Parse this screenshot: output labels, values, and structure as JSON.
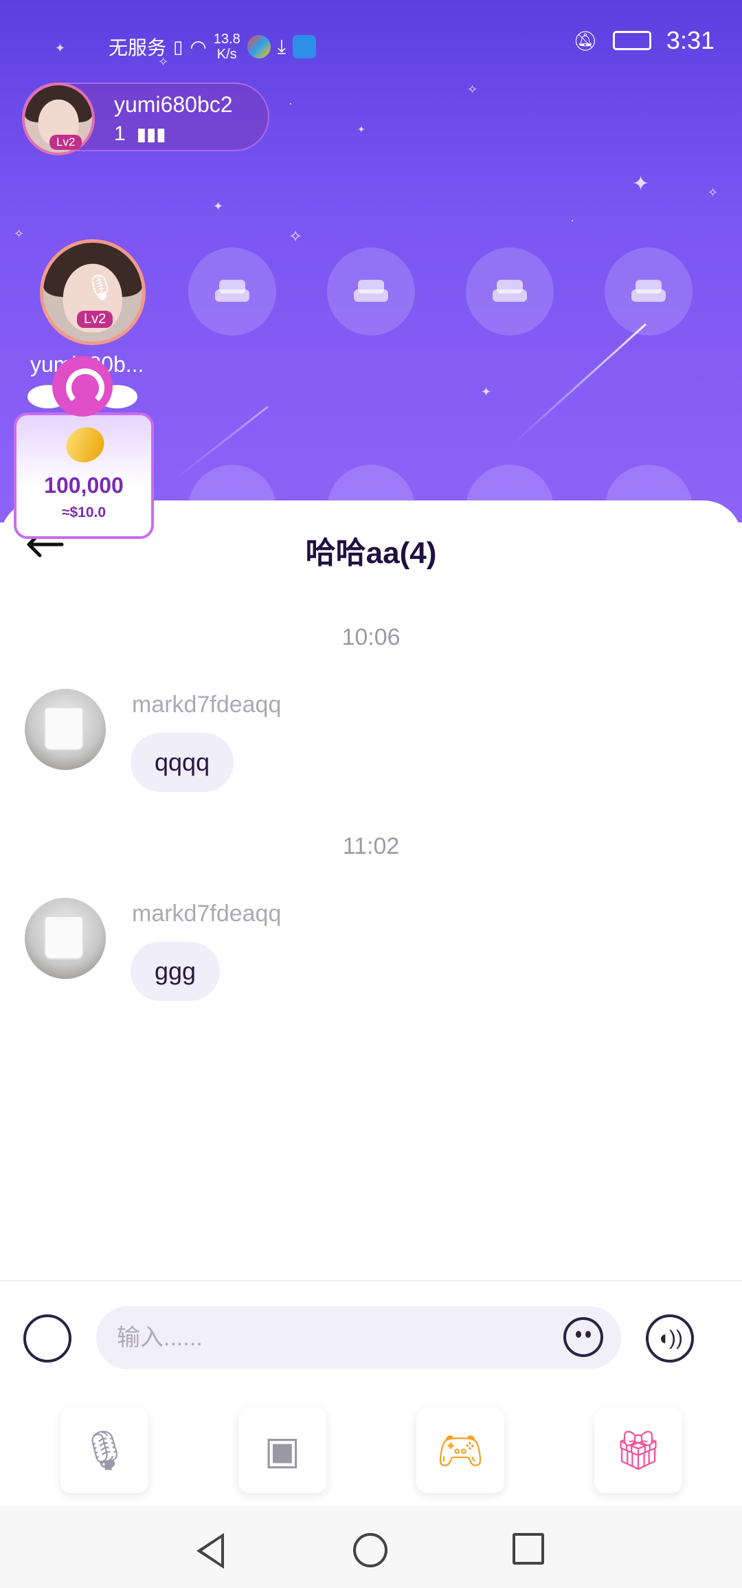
{
  "status_bar": {
    "carrier": "无服务",
    "speed_value": "13.8",
    "speed_unit": "K/s",
    "time": "3:31"
  },
  "room": {
    "host_name": "yumi680bc2",
    "host_level": "Lv2",
    "online_count": "1",
    "seat_host_name": "yumi680b...",
    "seat_host_level": "Lv2",
    "empty_seats": 4
  },
  "reward": {
    "amount": "100,000",
    "usd": "≈$10.0"
  },
  "chat": {
    "title": "哈哈aa(4)",
    "messages": [
      {
        "time": "10:06",
        "user": "markd7fdeaqq",
        "text": "qqqq"
      },
      {
        "time": "11:02",
        "user": "markd7fdeaqq",
        "text": "ggg"
      }
    ],
    "input_placeholder": "输入......"
  },
  "toolbar": {
    "icons": [
      "mic-sound-icon",
      "photo-frame-icon",
      "gamepad-icon",
      "gift-icon"
    ]
  },
  "colors": {
    "room_top": "#5b3fe0",
    "room_bottom": "#8e63f7",
    "title_text": "#1f1140",
    "bubble_bg": "#f0eef8",
    "gift_pink": "#f0509a",
    "game_orange": "#f5a023"
  }
}
